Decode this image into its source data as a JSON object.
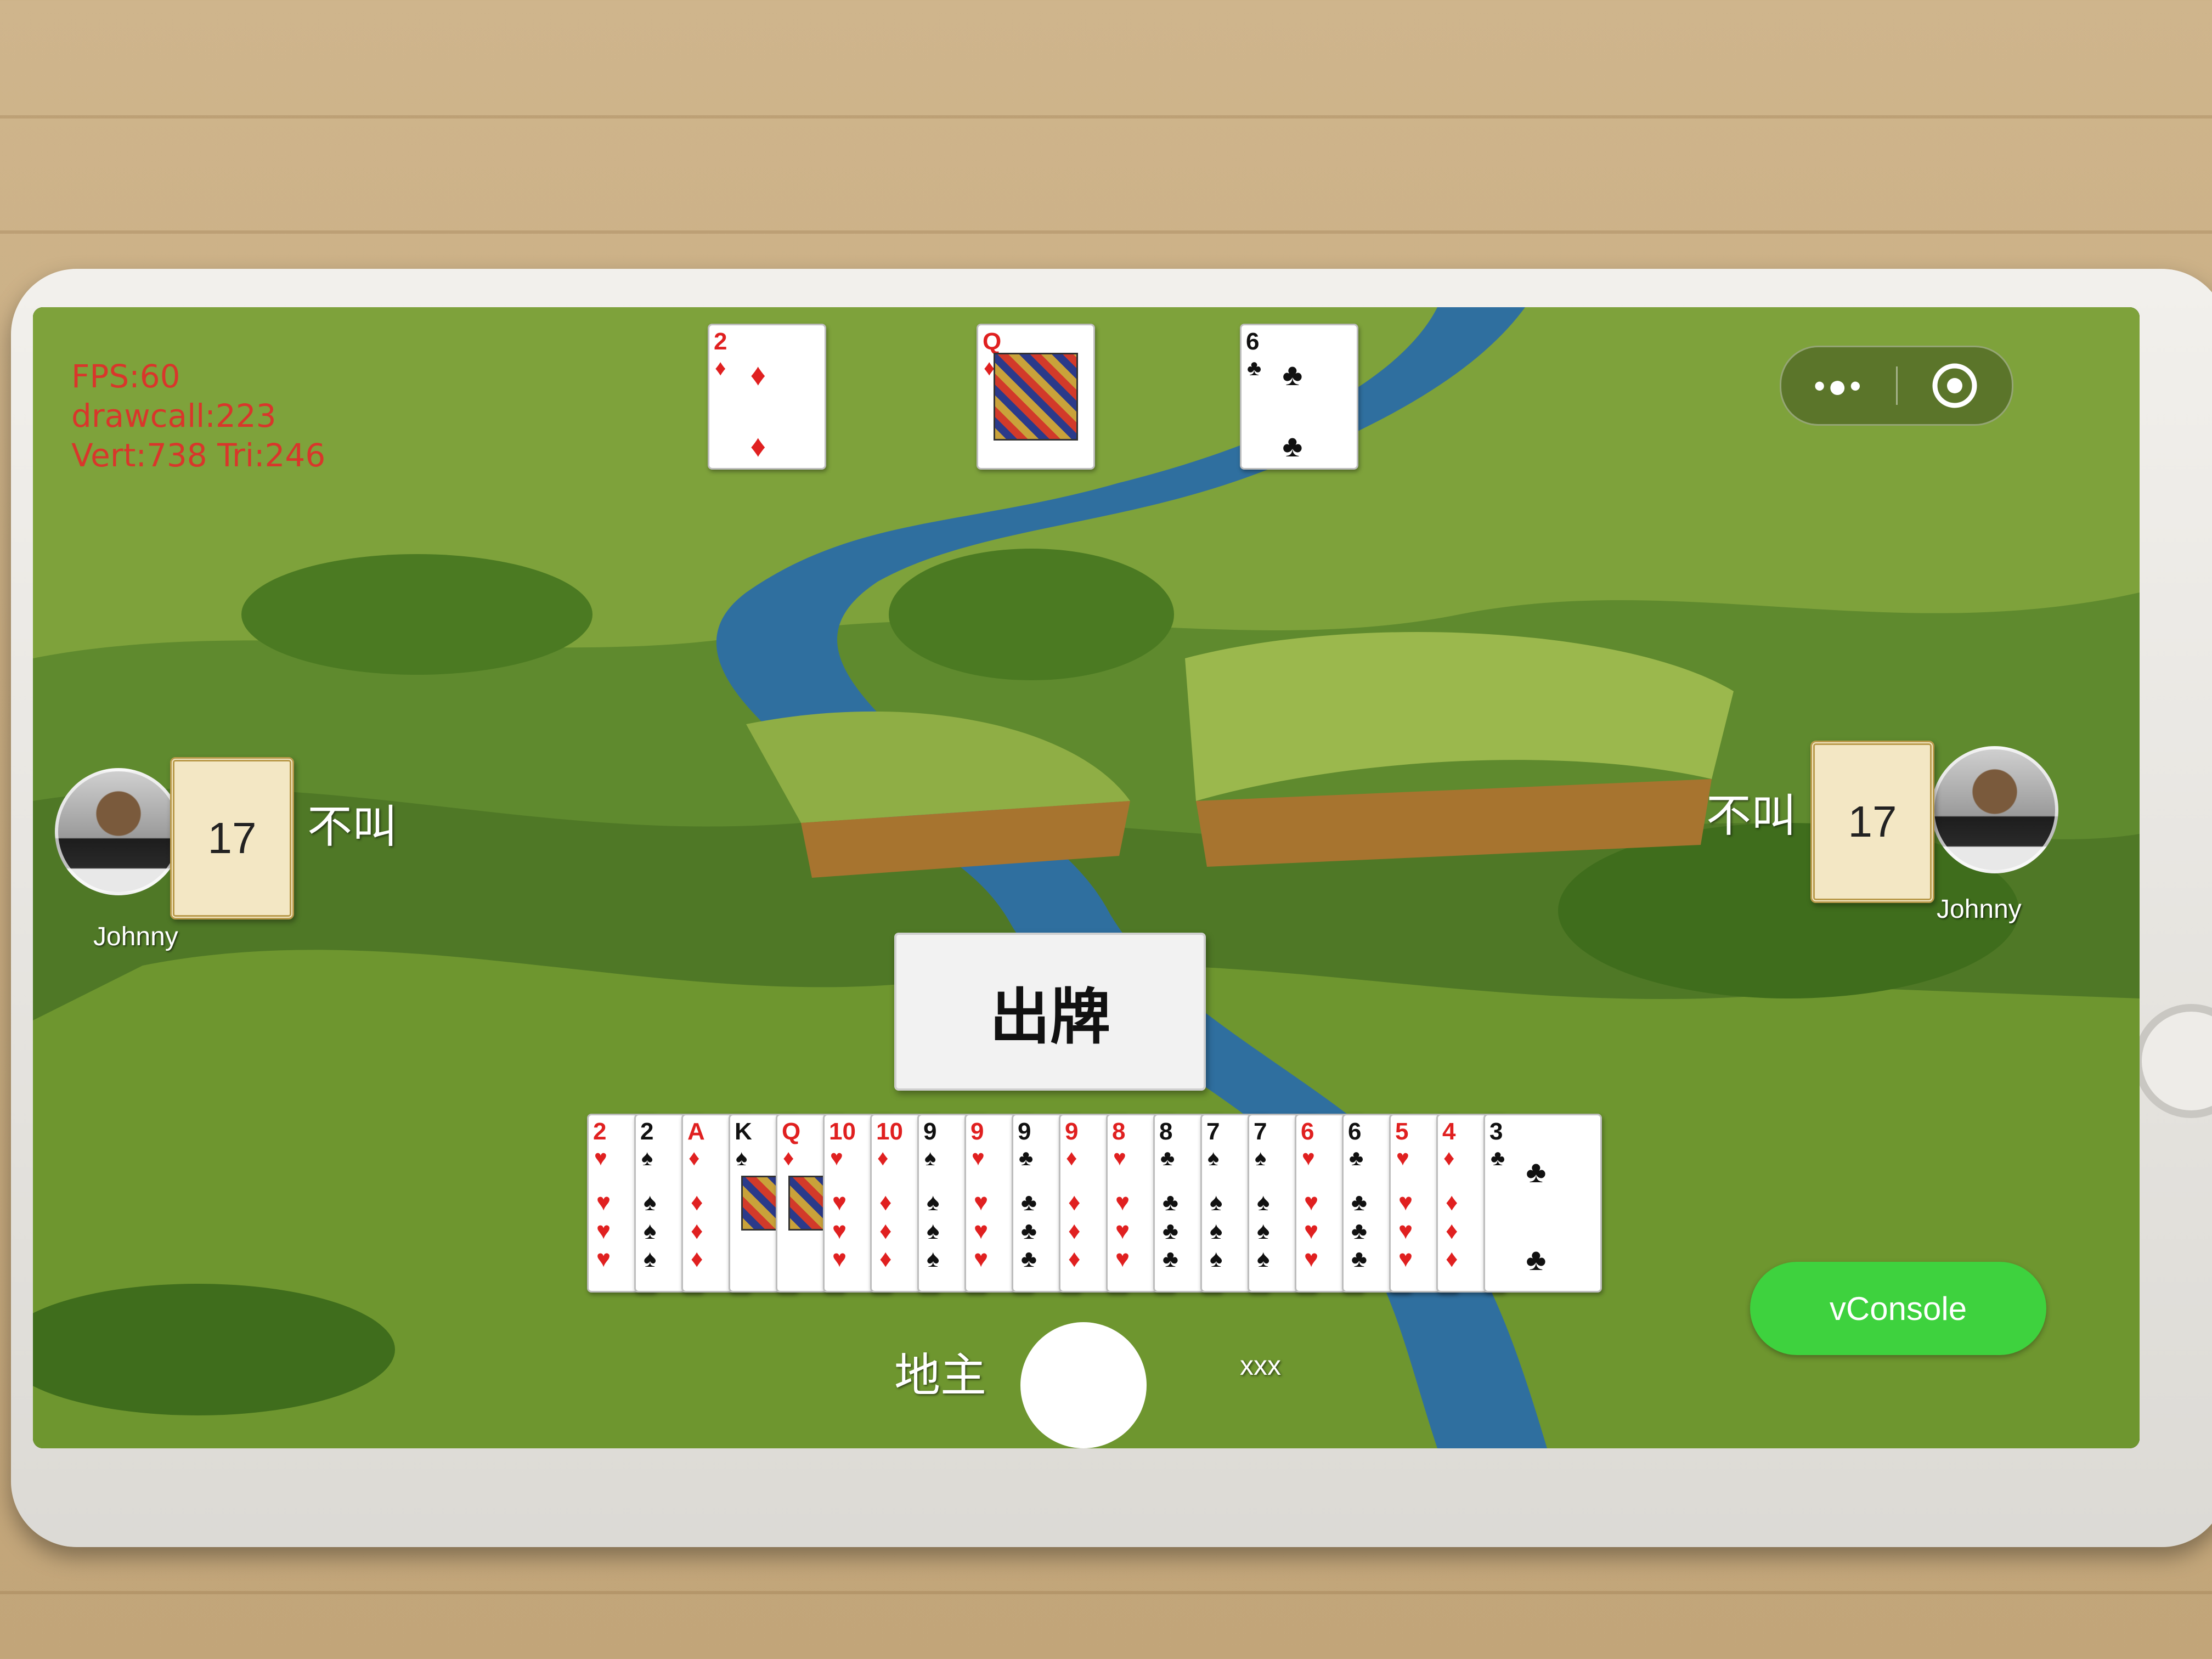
{
  "stats": {
    "fps": "FPS:60",
    "drawcall": "drawcall:223",
    "verts": "Vert:738  Tri:246"
  },
  "capsule": {
    "more_icon": "more-dots-icon",
    "close_icon": "target-close-icon"
  },
  "top_cards": [
    {
      "rank": "2",
      "suit": "♦",
      "color": "red"
    },
    {
      "rank": "Q",
      "suit": "♦",
      "color": "red",
      "face": true
    },
    {
      "rank": "6",
      "suit": "♣",
      "color": "black"
    }
  ],
  "left_player": {
    "name": "Johnny",
    "card_count": "17",
    "status": "不叫"
  },
  "right_player": {
    "name": "Johnny",
    "card_count": "17",
    "status": "不叫"
  },
  "play_button": {
    "label": "出牌"
  },
  "hand": [
    {
      "rank": "2",
      "suit": "♥",
      "color": "red"
    },
    {
      "rank": "2",
      "suit": "♠",
      "color": "black"
    },
    {
      "rank": "A",
      "suit": "♦",
      "color": "red"
    },
    {
      "rank": "K",
      "suit": "♠",
      "color": "black",
      "face": true
    },
    {
      "rank": "Q",
      "suit": "♦",
      "color": "red",
      "face": true
    },
    {
      "rank": "10",
      "suit": "♥",
      "color": "red"
    },
    {
      "rank": "10",
      "suit": "♦",
      "color": "red"
    },
    {
      "rank": "9",
      "suit": "♠",
      "color": "black"
    },
    {
      "rank": "9",
      "suit": "♥",
      "color": "red"
    },
    {
      "rank": "9",
      "suit": "♣",
      "color": "black"
    },
    {
      "rank": "9",
      "suit": "♦",
      "color": "red"
    },
    {
      "rank": "8",
      "suit": "♥",
      "color": "red"
    },
    {
      "rank": "8",
      "suit": "♣",
      "color": "black"
    },
    {
      "rank": "7",
      "suit": "♠",
      "color": "black"
    },
    {
      "rank": "7",
      "suit": "♠",
      "color": "black"
    },
    {
      "rank": "6",
      "suit": "♥",
      "color": "red"
    },
    {
      "rank": "6",
      "suit": "♣",
      "color": "black"
    },
    {
      "rank": "5",
      "suit": "♥",
      "color": "red"
    },
    {
      "rank": "4",
      "suit": "♦",
      "color": "red"
    },
    {
      "rank": "3",
      "suit": "♣",
      "color": "black"
    }
  ],
  "bottom": {
    "role": "地主",
    "name": "xxx"
  },
  "vconsole": {
    "label": "vConsole"
  }
}
